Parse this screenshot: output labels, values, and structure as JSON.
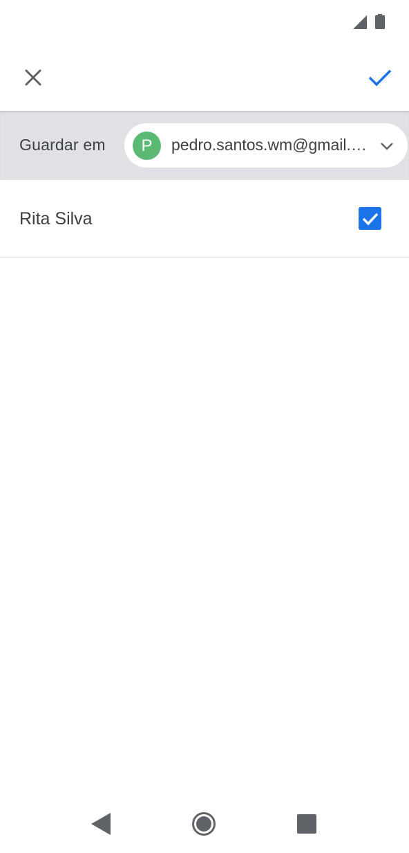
{
  "app_bar": {
    "close_icon": "close-icon",
    "save_icon": "check-icon",
    "accent_color": "#1a73e8"
  },
  "account_bar": {
    "label": "Guardar em",
    "avatar_letter": "P",
    "avatar_color": "#5bb974",
    "email": "pedro.santos.wm@gmail.com",
    "dropdown_icon": "chevron-down-icon"
  },
  "contacts": [
    {
      "name": "Rita Silva",
      "checked": true
    }
  ],
  "status_bar": {
    "icons": [
      "signal-icon",
      "battery-icon"
    ]
  },
  "nav_bar": {
    "icons": [
      "back-icon",
      "home-icon",
      "recents-icon"
    ]
  }
}
